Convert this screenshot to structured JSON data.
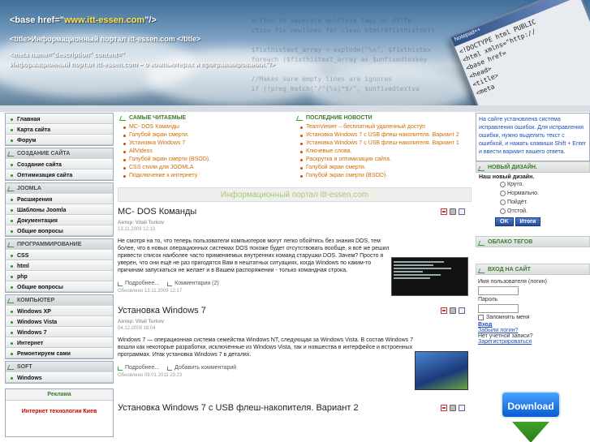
{
  "header": {
    "line1_prefix": "<base href=\"",
    "line1_url": "www.itt-essen.com",
    "line1_suffix": "\"/>",
    "line2": "<title>Информационный портал itt-essen.com </title>",
    "line3a": "<meta name=\"description\" content=\"",
    "line3b": "Информационный портал itt-essen.com – о компьютерах и программировании.\"/>",
    "code_lines": [
      "  ection to seperate multiple tags on diffe",
      "  ction fix_newlines_for_clean_html($fixthistext)",
      "",
      "  $fixthistext_array = explode(\"\\n\", $fixthistex",
      "  foreach ($fixthistext_array as $unfixedtexkey",
      "",
      "  //Makes sure empty lines are ignores",
      "  if (!preg_match(\"/^(\\s)*$/\", $unfixedtextva"
    ],
    "notepad_title": "Notepad++",
    "notepad_lines": [
      "<!DOCTYPE html PUBLIC",
      "<html xmlns=\"http://",
      "<base href=",
      "<head>",
      "<title>",
      "<meta"
    ]
  },
  "sidebar": {
    "top_items": [
      "Главная",
      "Карта сайта",
      "Форум"
    ],
    "sections": [
      {
        "title": "Создание сайта",
        "items": [
          "Создание сайта",
          "Оптимизация сайта"
        ]
      },
      {
        "title": "Joomla",
        "items": [
          "Расширения",
          "Шаблоны Joomla",
          "Документация",
          "Общие вопросы"
        ]
      },
      {
        "title": "Программирование",
        "items": [
          "CSS",
          "html",
          "php",
          "Общие вопросы"
        ]
      },
      {
        "title": "Компьютер",
        "items": [
          "Windows XP",
          "Windows Vista",
          "Windows 7",
          "Интернет",
          "Ремонтируем сами"
        ]
      },
      {
        "title": "Soft",
        "items": [
          "Windows"
        ]
      }
    ],
    "ad_title": "Реклама",
    "ad_link": "Интернет технологии Киев"
  },
  "most_read": {
    "title": "Самые читаемые",
    "items": [
      "MC- DOS Команды",
      "Голубой экран смерти.",
      "Установка Windows 7",
      "AllVideos",
      "Голубой экран смерти (BSOD).",
      "CSS стили для JOOMLA",
      "Подключение к интернету"
    ]
  },
  "latest_news": {
    "title": "Последние новости",
    "items": [
      "TeamViewer – бесплатный удаленный доступ",
      "Установка Windows 7 с USB флеш-накопителя. Вариант 2",
      "Установка Windows 7 с USB флеш-накопителя. Вариант 1",
      "Ключевые слова.",
      "Раскрутка и оптимизация сайта.",
      "Голубой экран смерти.",
      "Голубой экран смерти (BSOD)."
    ]
  },
  "portal_title": "Информационный портал itt-essen.com",
  "articles": [
    {
      "title": "MC- DOS Команды",
      "author": "Автор: Vitali Turkov",
      "date": "13.11.2009 12:13",
      "body": "Не смотря на то, что теперь пользователи компьютеров могут легко обойтись без знания DOS, тем более, что в новых операционных системах DOS похоже будет отсутствовать вообще, я всё же решил привести список наиболее часто применяемых внутренних команд старушки DOS. Зачем? Просто я уверен, что они ещё не раз пригодятся Вам в нештатных ситуациях, когда Windows по каким-то причинам запускаться не желает и в Вашем распоряжении - только командная строка.",
      "more": "Подробнее...",
      "comments": "Комментарии (2)",
      "modified": "Обновлено 13.11.2009 12:17"
    },
    {
      "title": "Установка Windows 7",
      "author": "Автор: Vitali Turkov",
      "date": "04.12.2009 18:04",
      "body": "Windows 7 — операционная система семейства Windows NT, следующая за Windows Vista. В состав Windows 7 вошли как некоторые разработки, исключённые из Windows Vista, так и новшества в интерфейсе и встроенных программах. Итак установка Windows 7 в деталях.",
      "more": "Подробнее...",
      "comments": "Добавить комментарий",
      "modified": "Обновлено 09.01.2011 23:23"
    },
    {
      "title": "Установка Windows 7 с USB флеш-накопителя. Вариант 2"
    }
  ],
  "right": {
    "note": "На сайте установлена система исправления ошибок. Для исправления ошибки, нужно выделить текст с ошибкой, и нажать клавиши Shift + Enter и ввести вариант вашего ответа.",
    "poll_title": "Новый дизайн.",
    "poll_question": "Наш новый дизайн.",
    "poll_options": [
      "Круто.",
      "Нормально.",
      "Пойдёт.",
      "Отстой."
    ],
    "poll_ok": "OK",
    "poll_results": "Итоги",
    "tags_title": "Облако тегов",
    "login_title": "Вход на сайт",
    "username_label": "Имя пользователя (логин)",
    "password_label": "Пароль",
    "remember_label": "Запомнить меня",
    "login_button": "Вход",
    "forgot_login": "Забыли логин?",
    "no_account": "Нет учетной записи?",
    "register": "Зарегистрироваться",
    "download": "Download"
  },
  "colors": {
    "accent_green": "#3d7a2a",
    "link_orange": "#d06a00",
    "link_blue": "#1a50c0"
  }
}
